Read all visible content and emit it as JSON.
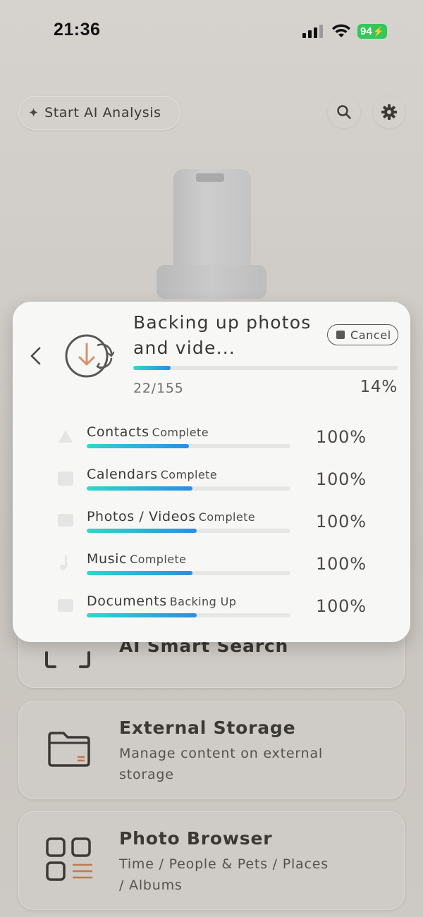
{
  "status_bar": {
    "time": "21:36",
    "battery": "94"
  },
  "top_bar": {
    "ai_button_label": "Start AI Analysis",
    "sparkle_icon": "sparkle-icon",
    "search_icon": "search-icon",
    "settings_icon": "gear-icon"
  },
  "cards": [
    {
      "title": "AI Smart Search",
      "icon": "ai-scan-icon"
    },
    {
      "title": "External Storage",
      "subtitle": "Manage content on external storage",
      "icon": "folder-icon"
    },
    {
      "title": "Photo Browser",
      "subtitle": "Time / People & Pets / Places / Albums",
      "icon": "grid-list-icon"
    }
  ],
  "backup": {
    "title": "Backing up photos and vide...",
    "cancel_label": "Cancel",
    "count": "22/155",
    "percent_label": "14%",
    "progress": 0.14,
    "items": [
      {
        "name": "Contacts",
        "status": "Complete",
        "percent_label": "100%",
        "bar_fill": 0.5
      },
      {
        "name": "Calendars",
        "status": "Complete",
        "percent_label": "100%",
        "bar_fill": 0.52
      },
      {
        "name": "Photos / Videos",
        "status": "Complete",
        "percent_label": "100%",
        "bar_fill": 0.54
      },
      {
        "name": "Music",
        "status": "Complete",
        "percent_label": "100%",
        "bar_fill": 0.52
      },
      {
        "name": "Documents",
        "status": "Backing Up",
        "percent_label": "100%",
        "bar_fill": 0.54
      }
    ]
  },
  "colors": {
    "accent_orange": "#d9906a",
    "progress_start": "#2dd9c8",
    "progress_end": "#2c8de6",
    "battery_green": "#34c759"
  }
}
